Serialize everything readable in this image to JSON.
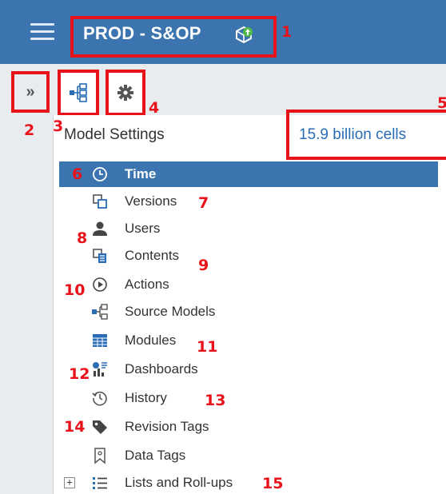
{
  "header": {
    "app_title": "PROD - S&OP",
    "title_icon": "cube-upload-icon"
  },
  "tabs": [
    {
      "name": "model-tree-tab",
      "icon": "hierarchy-icon"
    },
    {
      "name": "settings-tab",
      "icon": "gear-icon"
    }
  ],
  "expand_button": {
    "label": "»"
  },
  "panel": {
    "title": "Model Settings",
    "cells": "15.9 billion cells"
  },
  "tree_items": [
    {
      "label": "Time",
      "icon": "clock-icon",
      "selected": true
    },
    {
      "label": "Versions",
      "icon": "versions-icon"
    },
    {
      "label": "Users",
      "icon": "user-icon"
    },
    {
      "label": "Contents",
      "icon": "contents-icon"
    },
    {
      "label": "Actions",
      "icon": "play-circle-icon"
    },
    {
      "label": "Source Models",
      "icon": "source-models-icon"
    },
    {
      "label": "Modules",
      "icon": "grid-icon"
    },
    {
      "label": "Dashboards",
      "icon": "dashboard-icon"
    },
    {
      "label": "History",
      "icon": "history-icon"
    },
    {
      "label": "Revision Tags",
      "icon": "tag-icon"
    },
    {
      "label": "Data Tags",
      "icon": "bookmark-icon"
    },
    {
      "label": "Lists and Roll-ups",
      "icon": "list-icon",
      "expander": "+"
    }
  ],
  "markers": [
    "1",
    "2",
    "3",
    "4",
    "5",
    "6",
    "7",
    "8",
    "9",
    "10",
    "11",
    "12",
    "13",
    "14",
    "15"
  ],
  "colors": {
    "header": "#3b74ae",
    "selected_row": "#3b74ae",
    "annotation": "#e8121b",
    "cells_text": "#2a6db5",
    "rail": "#e9ecef"
  }
}
